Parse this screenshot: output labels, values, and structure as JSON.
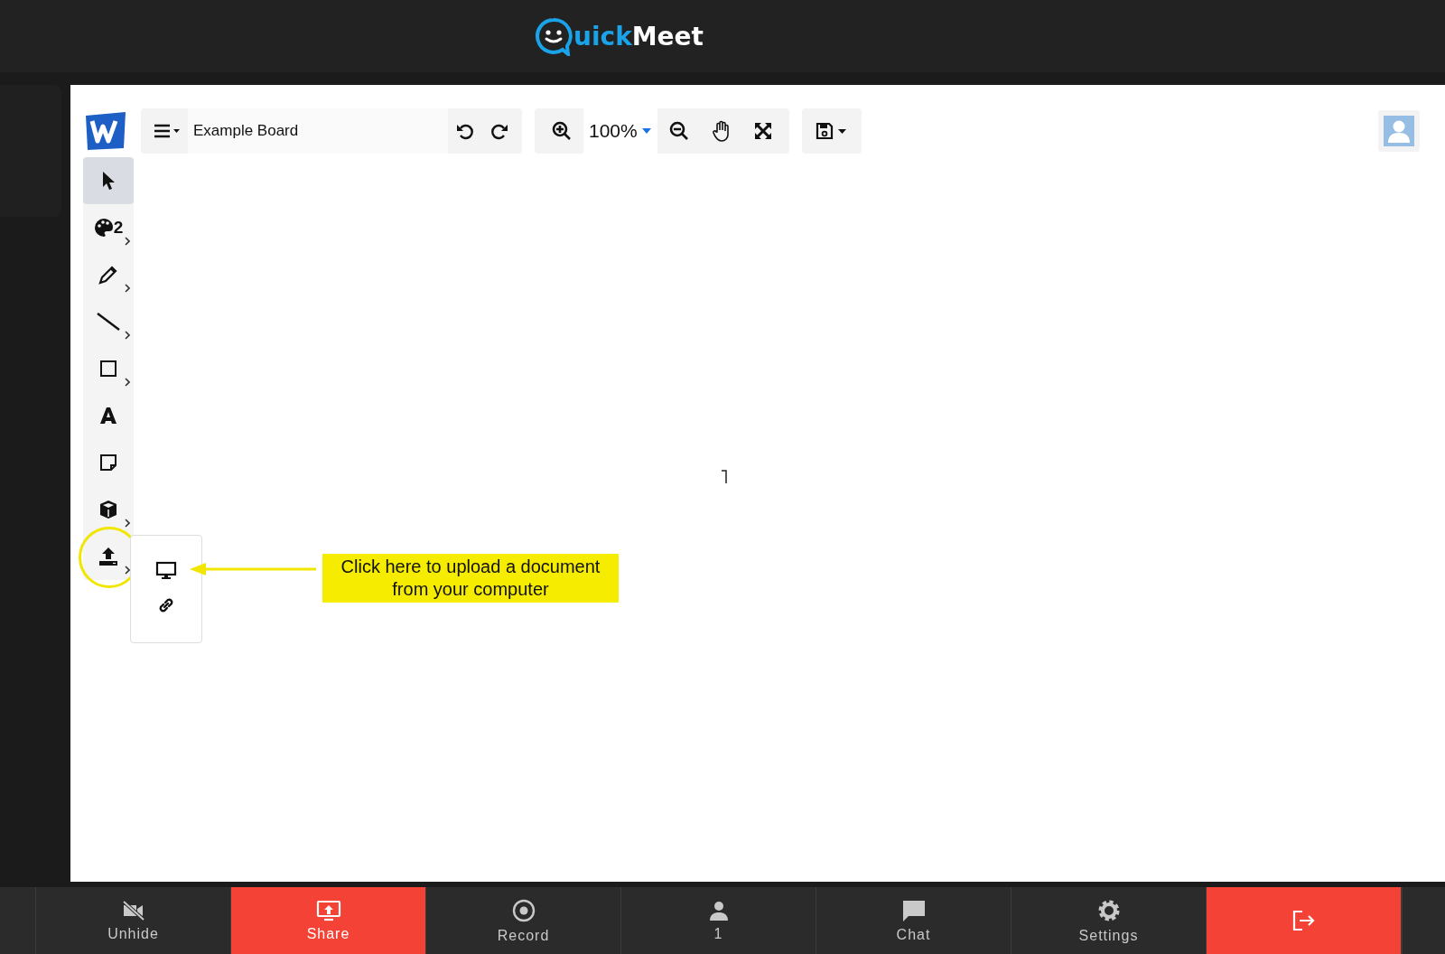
{
  "header": {
    "logo_first": "uick",
    "logo_second": "Meet"
  },
  "board": {
    "title": "Example Board",
    "zoom": "100%",
    "tools": [
      {
        "kind": "select",
        "selected": true,
        "submenu": false,
        "highlighted": false
      },
      {
        "kind": "palette",
        "selected": false,
        "submenu": true,
        "badge": "2",
        "highlighted": false
      },
      {
        "kind": "pencil",
        "selected": false,
        "submenu": true,
        "highlighted": false
      },
      {
        "kind": "line",
        "selected": false,
        "submenu": true,
        "highlighted": false
      },
      {
        "kind": "rect",
        "selected": false,
        "submenu": true,
        "highlighted": false
      },
      {
        "kind": "text",
        "selected": false,
        "submenu": false,
        "highlighted": false
      },
      {
        "kind": "note",
        "selected": false,
        "submenu": false,
        "highlighted": false
      },
      {
        "kind": "cube",
        "selected": false,
        "submenu": true,
        "highlighted": false
      },
      {
        "kind": "upload",
        "selected": false,
        "submenu": true,
        "highlighted": true
      }
    ],
    "upload_menu": [
      {
        "kind": "computer"
      },
      {
        "kind": "link"
      }
    ],
    "callout": "Click here to upload a document from your computer"
  },
  "bottom_bar": [
    {
      "kind": "camera-off",
      "label": "Unhide",
      "active": false
    },
    {
      "kind": "share",
      "label": "Share",
      "active": true
    },
    {
      "kind": "record",
      "label": "Record",
      "active": false
    },
    {
      "kind": "person",
      "label": "1",
      "active": false
    },
    {
      "kind": "chat",
      "label": "Chat",
      "active": false
    },
    {
      "kind": "settings",
      "label": "Settings",
      "active": false
    },
    {
      "kind": "leave",
      "active": true
    }
  ]
}
